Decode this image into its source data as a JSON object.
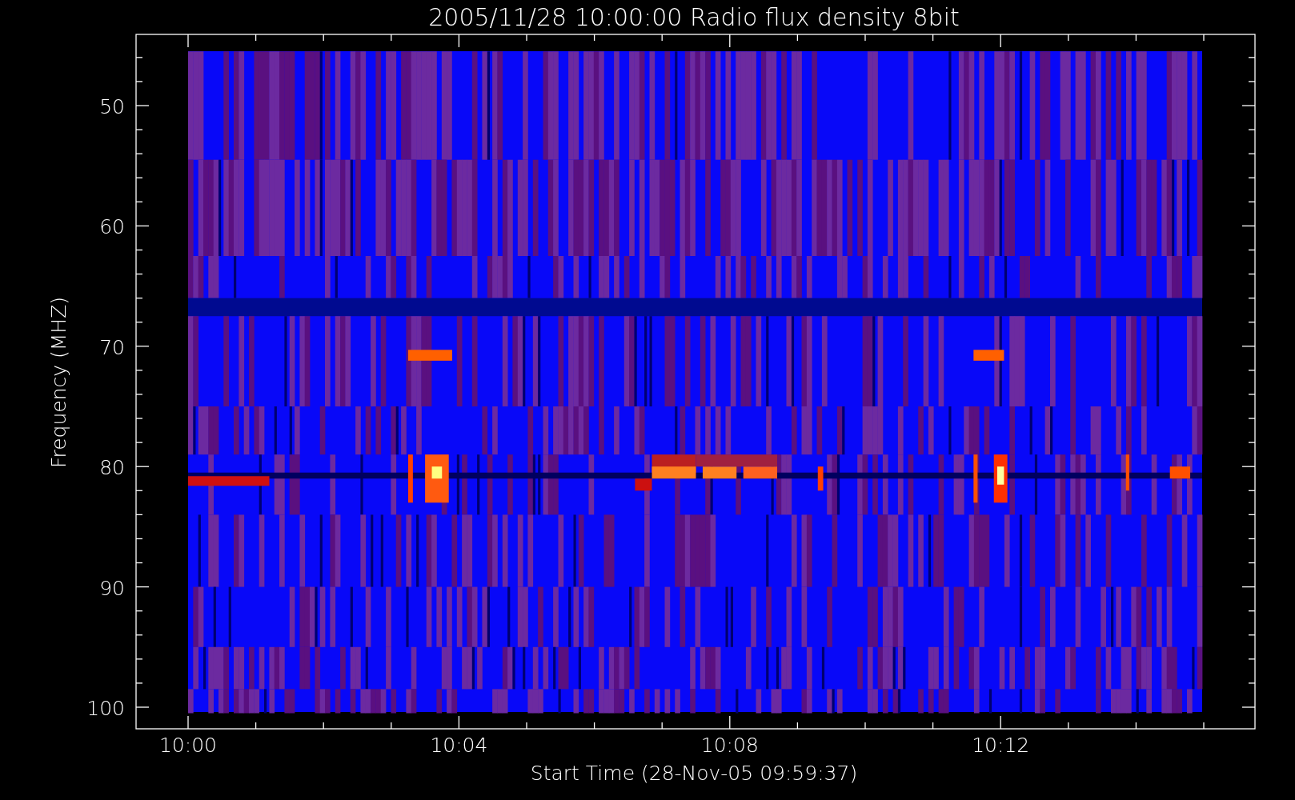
{
  "title": "2005/11/28 10:00:00 Radio flux density 8bit",
  "y_axis": {
    "label": "Frequency (MHZ)",
    "ticks": [
      "50",
      "60",
      "70",
      "80",
      "90",
      "100"
    ]
  },
  "x_axis": {
    "label": "Start Time (28-Nov-05 09:59:37)",
    "ticks": [
      "10:00",
      "10:04",
      "10:08",
      "10:12"
    ]
  }
}
